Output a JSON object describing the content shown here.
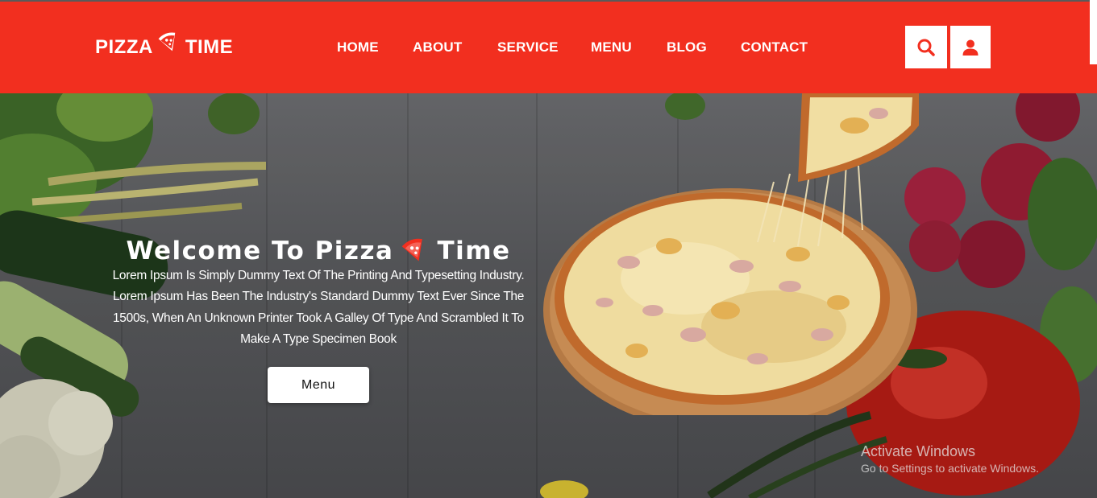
{
  "brand": {
    "part1": "PIZZA",
    "part2": "TIME"
  },
  "nav": {
    "items": [
      {
        "label": "HOME"
      },
      {
        "label": "ABOUT"
      },
      {
        "label": "SERVICE"
      },
      {
        "label": "MENU"
      },
      {
        "label": "BLOG"
      },
      {
        "label": "CONTACT"
      }
    ],
    "icons": {
      "search": "search-icon",
      "user": "user-icon"
    }
  },
  "hero": {
    "title_part1": "Welcome To Pizza",
    "title_part2": "Time",
    "description": "Lorem Ipsum Is Simply Dummy Text Of The Printing And Typesetting Industry. Lorem Ipsum Has Been The Industry's Standard Dummy Text Ever Since The 1500s, When An Unknown Printer Took A Galley Of Type And Scrambled It To Make A Type Specimen Book",
    "button_label": "Menu"
  },
  "watermark": {
    "line1": "Activate Windows",
    "line2": "Go to Settings to activate Windows."
  },
  "colors": {
    "brand_red": "#f22f1f",
    "white": "#ffffff"
  }
}
